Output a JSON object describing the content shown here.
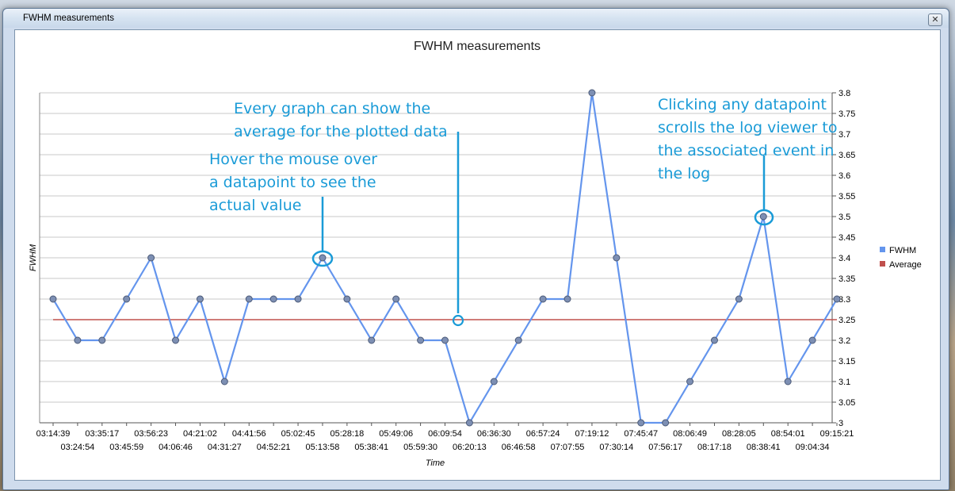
{
  "window": {
    "title": "FWHM measurements",
    "close_glyph": "✕"
  },
  "annotations": {
    "average": [
      "Every graph can show the",
      "average for the plotted data"
    ],
    "hover": [
      "Hover the mouse over",
      "a datapoint to see the",
      "actual value"
    ],
    "click": [
      "Clicking any datapoint",
      "scrolls the log viewer to",
      "the associated event in",
      "the log"
    ]
  },
  "chart_data": {
    "type": "line",
    "title": "FWHM measurements",
    "xlabel": "Time",
    "ylabel": "FWHM",
    "ylim": [
      3,
      3.8
    ],
    "yticks": [
      "3",
      "3.05",
      "3.1",
      "3.15",
      "3.2",
      "3.25",
      "3.3",
      "3.35",
      "3.4",
      "3.45",
      "3.5",
      "3.55",
      "3.6",
      "3.65",
      "3.7",
      "3.75",
      "3.8"
    ],
    "yaxis_side": "right",
    "grid": "horizontal",
    "legend_position": "right",
    "x": [
      "03:14:39",
      "03:24:54",
      "03:35:17",
      "03:45:59",
      "03:56:23",
      "04:06:46",
      "04:21:02",
      "04:31:27",
      "04:41:56",
      "04:52:21",
      "05:02:45",
      "05:13:58",
      "05:28:18",
      "05:38:41",
      "05:49:06",
      "05:59:30",
      "06:09:54",
      "06:20:13",
      "06:36:30",
      "06:46:58",
      "06:57:24",
      "07:07:55",
      "07:19:12",
      "07:30:14",
      "07:45:47",
      "07:56:17",
      "08:06:49",
      "08:17:18",
      "08:28:05",
      "08:38:41",
      "08:54:01",
      "09:04:34",
      "09:15:21"
    ],
    "series": [
      {
        "name": "FWHM",
        "color": "#6495ed",
        "values": [
          3.3,
          3.2,
          3.2,
          3.3,
          3.4,
          3.2,
          3.3,
          3.1,
          3.3,
          3.3,
          3.3,
          3.4,
          3.3,
          3.2,
          3.3,
          3.2,
          3.2,
          3.0,
          3.1,
          3.2,
          3.3,
          3.3,
          3.8,
          3.4,
          3.0,
          3.0,
          3.1,
          3.2,
          3.3,
          3.5,
          3.1,
          3.2,
          3.3
        ]
      },
      {
        "name": "Average",
        "color": "#c0504d",
        "values": [
          3.25
        ]
      }
    ]
  },
  "colors": {
    "annotation": "#1a9bd7",
    "grid": "#c8c8c8"
  }
}
